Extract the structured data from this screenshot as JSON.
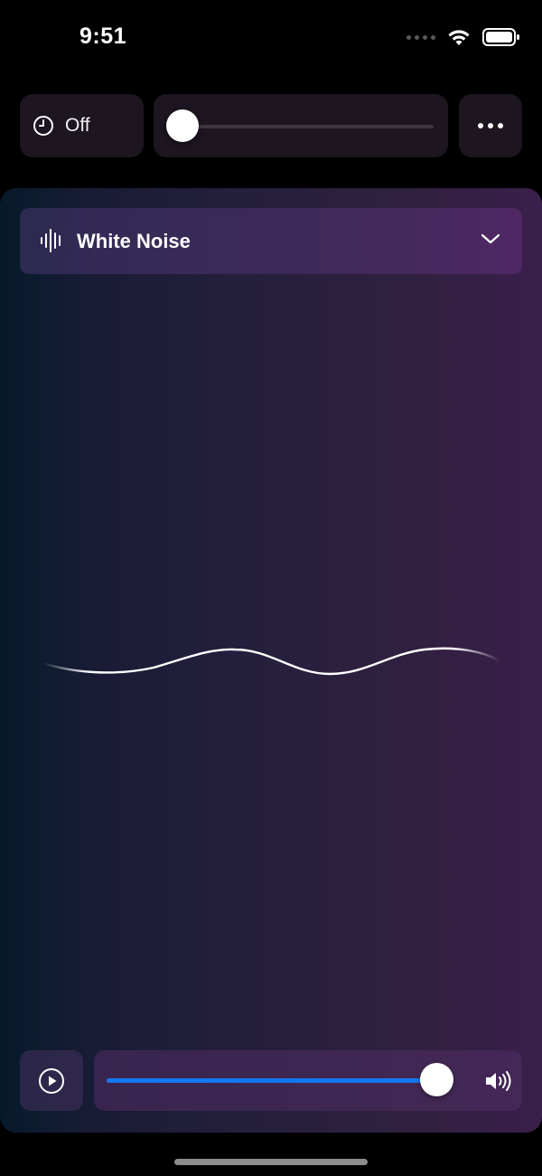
{
  "status_bar": {
    "time": "9:51",
    "icons": [
      "cellular-signal-icon",
      "wifi-icon",
      "battery-icon"
    ]
  },
  "top_controls": {
    "timer_label": "Off",
    "timer_icon": "clock-icon",
    "top_slider_value": 0,
    "more_icon": "ellipsis-icon"
  },
  "sound_selector": {
    "icon": "waveform-icon",
    "name": "White Noise",
    "chevron_icon": "chevron-down-icon"
  },
  "player": {
    "play_icon": "play-circle-icon",
    "volume_fraction": 0.97,
    "volume_icon": "speaker-wave-icon",
    "accent_color": "#1478f0"
  },
  "colors": {
    "background": "#000000",
    "panel_start": "#061a2b",
    "panel_end": "#3a1f4b",
    "control_bg": "#1d1520"
  }
}
